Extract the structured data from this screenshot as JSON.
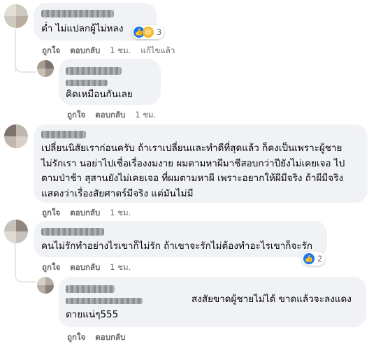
{
  "colors": {
    "bubble": "#f0f2f5",
    "meta": "#65676b",
    "like": "#1877f2",
    "haha": "#f7b928"
  },
  "comments": [
    {
      "text_lines": [
        "ต่ำ ไม่แปลกผู้ไม่หลง"
      ],
      "like": "ถูกใจ",
      "reply": "ตอบกลับ",
      "time": "1 ชม.",
      "edited": "แก้ไขแล้ว",
      "reactions": {
        "icons": [
          "like-icon",
          "haha-icon"
        ],
        "count": "3"
      }
    },
    {
      "text_lines": [
        "คิดเหมือนกันเลย"
      ],
      "like": "ถูกใจ",
      "reply": "ตอบกลับ",
      "time": "1 ชม."
    },
    {
      "text_lines": [
        "เปลี่ยนนิสัยเราก่อนครับ ถ้าเราเปลี่ยนและทำดีที่สุดแล้ว ก็คงเป็นเพราะผู้ชาย",
        "ไม่รักเรา นอย่าไปเชื่อเรื่องงมงาย ผมตามหาผีมาชีสอบกว่าปียังไม่เคยเจอ ไป",
        "ตามป่าช้า สุสานยังไม่เคยเจอ ที่ผมตามหาผี เพราะอยากให้ผีมีจริง ถ้าผีมีจริง",
        "แสดงว่าเรื่องสัยศาตร์มีจริง แต่มันไม่มี"
      ],
      "like": "ถูกใจ",
      "reply": "ตอบกลับ",
      "time": "1 ชม."
    },
    {
      "text_lines": [
        "คนไม่รักทำอย่างไรเขาก็ไม่รัก ถ้าเขาจะรักไม่ต้องทำอะไรเขาก็จะรัก"
      ],
      "like": "ถูกใจ",
      "reply": "ตอบกลับ",
      "time": "1 ชม.",
      "reactions": {
        "icons": [
          "like-icon"
        ],
        "count": "2"
      }
    },
    {
      "text_lines": [
        "สงสัยขาดผู้ชายไม่ได้ ขาดแล้วจะลงแดง",
        "ตายแน่ๆ555"
      ],
      "like": "ถูกใจ",
      "reply": "ตอบกลับ",
      "time": ""
    }
  ]
}
